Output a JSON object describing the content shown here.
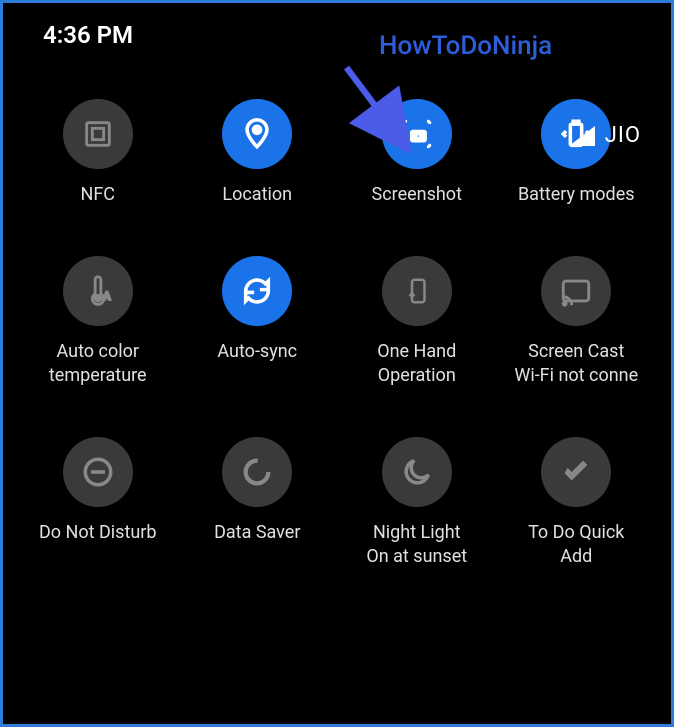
{
  "status": {
    "time": "4:36 PM",
    "carrier": "JIO"
  },
  "watermark": "HowToDoNinja",
  "tiles": [
    {
      "label": "NFC",
      "active": false,
      "icon": "nfc-icon"
    },
    {
      "label": "Location",
      "active": true,
      "icon": "location-icon"
    },
    {
      "label": "Screenshot",
      "active": true,
      "icon": "screenshot-icon"
    },
    {
      "label": "Battery modes",
      "active": true,
      "icon": "battery-icon"
    },
    {
      "label": "Auto color\ntemperature",
      "active": false,
      "icon": "thermometer-icon"
    },
    {
      "label": "Auto-sync",
      "active": true,
      "icon": "sync-icon"
    },
    {
      "label": "One Hand\nOperation",
      "active": false,
      "icon": "onehand-icon"
    },
    {
      "label": "Screen Cast\nWi-Fi not conne",
      "active": false,
      "icon": "cast-icon"
    },
    {
      "label": "Do Not Disturb",
      "active": false,
      "icon": "dnd-icon"
    },
    {
      "label": "Data Saver",
      "active": false,
      "icon": "datasaver-icon"
    },
    {
      "label": "Night Light\nOn at sunset",
      "active": false,
      "icon": "nightlight-icon"
    },
    {
      "label": "To Do Quick\nAdd",
      "active": false,
      "icon": "todo-icon"
    }
  ]
}
